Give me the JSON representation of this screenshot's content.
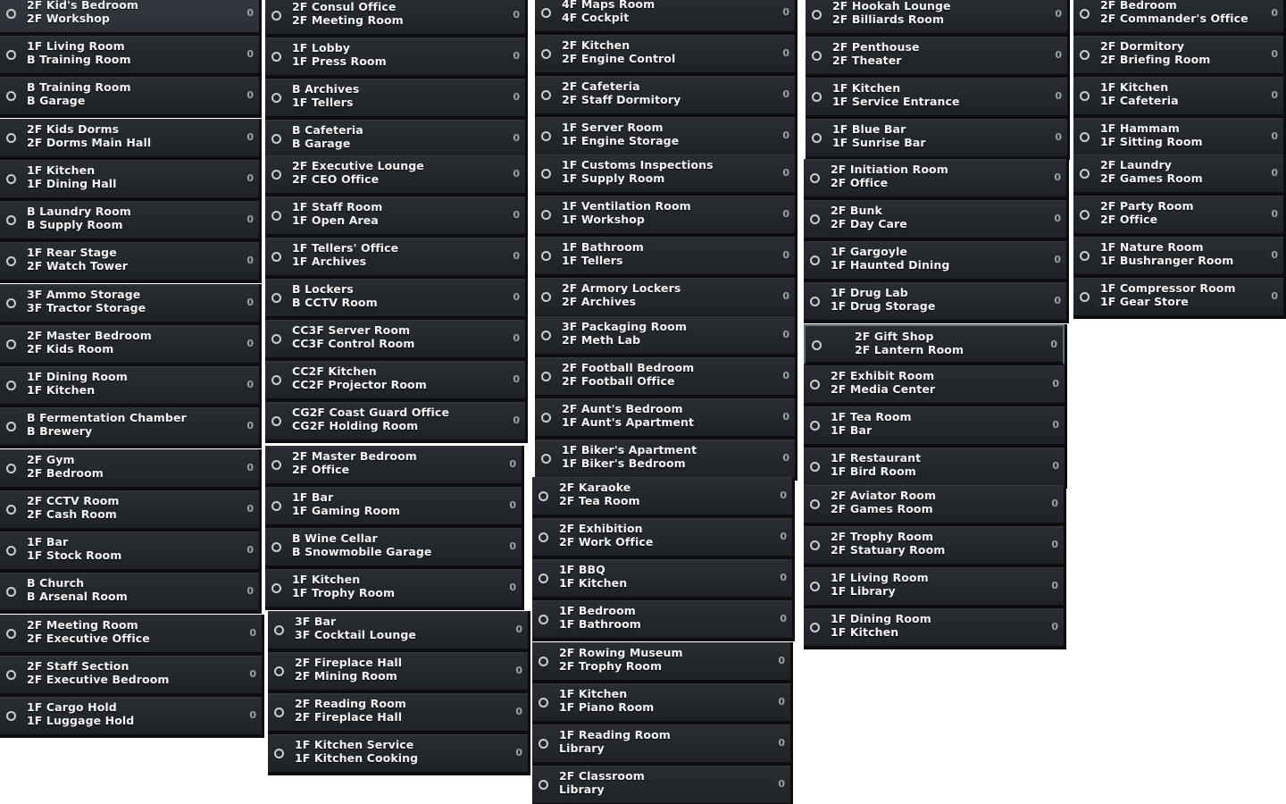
{
  "columns": [
    {
      "groups": [
        {
          "items": [
            {
              "top": "2F Kid's Bedroom",
              "bottom": "2F Workshop",
              "count": "0"
            },
            {
              "top": "1F Living Room",
              "bottom": "B Training Room",
              "count": "0"
            },
            {
              "top": "B Training Room",
              "bottom": "B Garage",
              "count": "0"
            }
          ]
        },
        {
          "items": [
            {
              "top": "2F Kids Dorms",
              "bottom": "2F Dorms Main Hall",
              "count": "0"
            },
            {
              "top": "1F Kitchen",
              "bottom": "1F Dining Hall",
              "count": "0"
            },
            {
              "top": "B Laundry Room",
              "bottom": "B Supply Room",
              "count": "0"
            },
            {
              "top": "1F Rear Stage",
              "bottom": "2F Watch Tower",
              "count": "0"
            }
          ]
        },
        {
          "items": [
            {
              "top": "3F Ammo Storage",
              "bottom": "3F Tractor Storage",
              "count": "0"
            },
            {
              "top": "2F Master Bedroom",
              "bottom": "2F Kids Room",
              "count": "0"
            },
            {
              "top": "1F Dining Room",
              "bottom": "1F Kitchen",
              "count": "0"
            },
            {
              "top": "B Fermentation Chamber",
              "bottom": "B Brewery",
              "count": "0"
            }
          ]
        },
        {
          "items": [
            {
              "top": "2F Gym",
              "bottom": "2F Bedroom",
              "count": "0"
            },
            {
              "top": "2F CCTV Room",
              "bottom": "2F Cash Room",
              "count": "0"
            },
            {
              "top": "1F Bar",
              "bottom": "1F Stock Room",
              "count": "0"
            },
            {
              "top": "B Church",
              "bottom": "B Arsenal Room",
              "count": "0"
            }
          ]
        },
        {
          "items": [
            {
              "top": "2F Meeting Room",
              "bottom": "2F Executive Office",
              "count": "0"
            },
            {
              "top": "2F Staff Section",
              "bottom": "2F Executive Bedroom",
              "count": "0"
            },
            {
              "top": "1F Cargo Hold",
              "bottom": "1F Luggage Hold",
              "count": "0"
            }
          ]
        }
      ]
    },
    {
      "groups": [
        {
          "items": [
            {
              "top": "2F Consul Office",
              "bottom": "2F Meeting Room",
              "count": "0"
            },
            {
              "top": "1F Lobby",
              "bottom": "1F Press Room",
              "count": "0"
            },
            {
              "top": "B Archives",
              "bottom": "1F Tellers",
              "count": "0"
            },
            {
              "top": "B Cafeteria",
              "bottom": "B Garage",
              "count": "0"
            }
          ]
        },
        {
          "items": [
            {
              "top": "2F Executive Lounge",
              "bottom": "2F CEO Office",
              "count": "0"
            },
            {
              "top": "1F Staff Room",
              "bottom": "1F Open Area",
              "count": "0"
            },
            {
              "top": "1F Tellers' Office",
              "bottom": "1F Archives",
              "count": "0"
            },
            {
              "top": "B Lockers",
              "bottom": "B CCTV Room",
              "count": "0"
            }
          ]
        },
        {
          "items": [
            {
              "top": "CC3F Server Room",
              "bottom": "CC3F Control Room",
              "count": "0"
            },
            {
              "top": "CC2F Kitchen",
              "bottom": "CC2F Projector Room",
              "count": "0"
            },
            {
              "top": "CG2F Coast Guard Office",
              "bottom": "CG2F Holding Room",
              "count": "0"
            }
          ]
        },
        {
          "items": [
            {
              "top": "2F Master Bedroom",
              "bottom": "2F Office",
              "count": "0"
            },
            {
              "top": "1F Bar",
              "bottom": "1F Gaming Room",
              "count": "0"
            },
            {
              "top": "B Wine Cellar",
              "bottom": "B Snowmobile Garage",
              "count": "0"
            },
            {
              "top": "1F Kitchen",
              "bottom": "1F Trophy Room",
              "count": "0"
            }
          ]
        },
        {
          "items": [
            {
              "top": "3F Bar",
              "bottom": "3F Cocktail Lounge",
              "count": "0"
            },
            {
              "top": "2F Fireplace Hall",
              "bottom": "2F Mining Room",
              "count": "0"
            },
            {
              "top": "2F Reading Room",
              "bottom": "2F Fireplace Hall",
              "count": "0"
            },
            {
              "top": "1F Kitchen Service",
              "bottom": "1F Kitchen Cooking",
              "count": "0"
            }
          ]
        }
      ]
    },
    {
      "groups": [
        {
          "items": [
            {
              "top": "4F Maps Room",
              "bottom": "4F Cockpit",
              "count": "0"
            },
            {
              "top": "2F Kitchen",
              "bottom": "2F Engine Control",
              "count": "0"
            },
            {
              "top": "2F Cafeteria",
              "bottom": "2F Staff Dormitory",
              "count": "0"
            },
            {
              "top": "1F Server Room",
              "bottom": "1F Engine Storage",
              "count": "0"
            }
          ]
        },
        {
          "items": [
            {
              "top": "1F Customs Inspections",
              "bottom": "1F Supply Room",
              "count": "0"
            },
            {
              "top": "1F Ventilation Room",
              "bottom": "1F Workshop",
              "count": "0"
            },
            {
              "top": "1F Bathroom",
              "bottom": "1F Tellers",
              "count": "0"
            },
            {
              "top": "2F Armory Lockers",
              "bottom": "2F Archives",
              "count": "0"
            }
          ]
        },
        {
          "items": [
            {
              "top": "3F Packaging Room",
              "bottom": "2F Meth Lab",
              "count": "0"
            },
            {
              "top": "2F Football Bedroom",
              "bottom": "2F Football Office",
              "count": "0"
            },
            {
              "top": "2F Aunt's Bedroom",
              "bottom": "1F Aunt's Apartment",
              "count": "0"
            },
            {
              "top": "1F Biker's Apartment",
              "bottom": "1F Biker's Bedroom",
              "count": "0"
            }
          ]
        },
        {
          "items": [
            {
              "top": "2F Karaoke",
              "bottom": "2F Tea Room",
              "count": "0"
            },
            {
              "top": "2F Exhibition",
              "bottom": "2F Work Office",
              "count": "0"
            },
            {
              "top": "1F BBQ",
              "bottom": "1F Kitchen",
              "count": "0"
            },
            {
              "top": "1F Bedroom",
              "bottom": "1F Bathroom",
              "count": "0"
            }
          ]
        },
        {
          "items": [
            {
              "top": "2F Rowing Museum",
              "bottom": "2F Trophy Room",
              "count": "0"
            },
            {
              "top": "1F Kitchen",
              "bottom": "1F Piano Room",
              "count": "0"
            },
            {
              "top": "1F Reading Room",
              "bottom": "Library",
              "count": "0"
            },
            {
              "top": "2F Classroom",
              "bottom": "Library",
              "count": "0"
            }
          ]
        }
      ]
    },
    {
      "groups": [
        {
          "items": [
            {
              "top": "2F Hookah Lounge",
              "bottom": "2F Billiards Room",
              "count": "0"
            },
            {
              "top": "2F Penthouse",
              "bottom": "2F Theater",
              "count": "0"
            },
            {
              "top": "1F Kitchen",
              "bottom": "1F Service Entrance",
              "count": "0"
            },
            {
              "top": "1F Blue Bar",
              "bottom": "1F Sunrise Bar",
              "count": "0"
            }
          ]
        },
        {
          "items": [
            {
              "top": "2F Initiation Room",
              "bottom": "2F Office",
              "count": "0"
            },
            {
              "top": "2F Bunk",
              "bottom": "2F Day Care",
              "count": "0"
            },
            {
              "top": "1F Gargoyle",
              "bottom": "1F Haunted Dining",
              "count": "0"
            },
            {
              "top": "1F Drug Lab",
              "bottom": "1F Drug Storage",
              "count": "0"
            }
          ]
        },
        {
          "items": [
            {
              "top": "2F Gift Shop",
              "bottom": "2F Lantern Room",
              "count": "0",
              "selected": "yes"
            },
            {
              "top": "2F Exhibit Room",
              "bottom": "2F Media Center",
              "count": "0"
            },
            {
              "top": "1F Tea Room",
              "bottom": "1F Bar",
              "count": "0"
            },
            {
              "top": "1F Restaurant",
              "bottom": "1F Bird Room",
              "count": "0"
            }
          ]
        },
        {
          "items": [
            {
              "top": "2F Aviator Room",
              "bottom": "2F Games Room",
              "count": "0"
            },
            {
              "top": "2F Trophy Room",
              "bottom": "2F Statuary Room",
              "count": "0"
            },
            {
              "top": "1F Living Room",
              "bottom": "1F Library",
              "count": "0"
            },
            {
              "top": "1F Dining Room",
              "bottom": "1F Kitchen",
              "count": "0"
            }
          ]
        }
      ]
    },
    {
      "groups": [
        {
          "items": [
            {
              "top": "2F Bedroom",
              "bottom": "2F Commander's Office",
              "count": "0"
            },
            {
              "top": "2F Dormitory",
              "bottom": "2F Briefing Room",
              "count": "0"
            },
            {
              "top": "1F Kitchen",
              "bottom": "1F Cafeteria",
              "count": "0"
            },
            {
              "top": "1F Hammam",
              "bottom": "1F Sitting Room",
              "count": "0"
            }
          ]
        },
        {
          "items": [
            {
              "top": "2F Laundry",
              "bottom": "2F Games Room",
              "count": "0"
            },
            {
              "top": "2F Party Room",
              "bottom": "2F Office",
              "count": "0"
            },
            {
              "top": "1F Nature Room",
              "bottom": "1F Bushranger Room",
              "count": "0"
            },
            {
              "top": "1F Compressor Room",
              "bottom": "1F Gear Store",
              "count": "0"
            }
          ]
        }
      ]
    }
  ]
}
